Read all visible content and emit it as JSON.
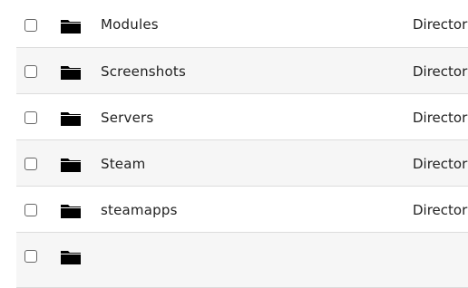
{
  "rows": [
    {
      "name": "Modules",
      "type": "Director",
      "icon": "folder-icon"
    },
    {
      "name": "Screenshots",
      "type": "Director",
      "icon": "folder-icon"
    },
    {
      "name": "Servers",
      "type": "Director",
      "icon": "folder-icon"
    },
    {
      "name": "Steam",
      "type": "Director",
      "icon": "folder-icon"
    },
    {
      "name": "steamapps",
      "type": "Director",
      "icon": "folder-icon"
    }
  ]
}
